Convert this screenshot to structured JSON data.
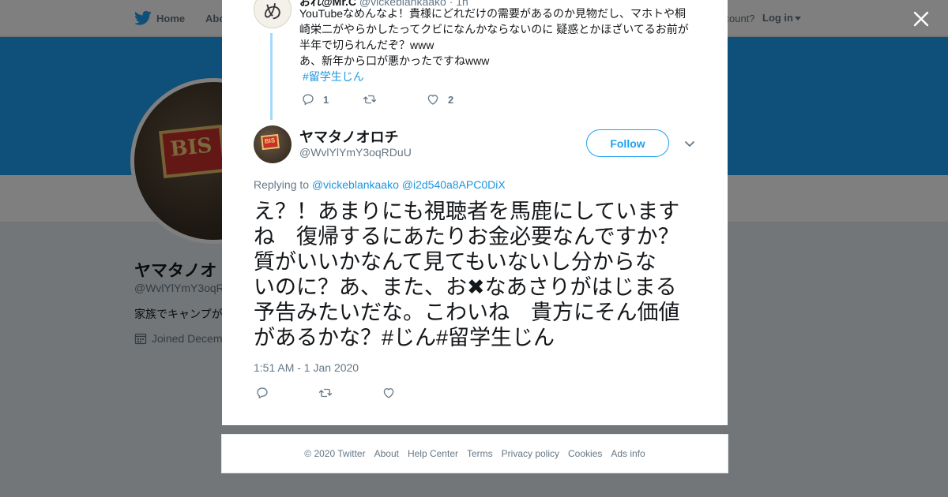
{
  "topnav": {
    "home_label": "Home",
    "about_label": "Abo",
    "account_prompt": "ccount?",
    "login_label": "Log in"
  },
  "profile": {
    "name": "ヤマタノオ",
    "handle": "@WvlYlYmY3oqR",
    "bio": "家族でキャンプが",
    "joined": "Joined Decem",
    "avatar_label": "BIS"
  },
  "reply_tweet": {
    "header_name": "おれ@Mr.C",
    "header_handle": "@vickeblankaako · 1h",
    "avatar_glyph": "め",
    "text_lines": [
      "YouTubeなめんなよ！貴様にどれだけの需要があるのか見物だし、マホトや桐",
      "崎栄二がやらかしたってクビになんかならないのに 疑惑とかほざいてるお前が",
      "半年で切られんだぞ？www",
      "あ、新年から口が悪かったですねwww"
    ],
    "hashtag": "#留学生じん",
    "reply_count": "1",
    "retweet_count": "",
    "like_count": "2"
  },
  "main_tweet": {
    "name": "ヤマタノオロチ",
    "handle": "@WvlYlYmY3oqRDuU",
    "avatar_label": "BIS",
    "follow_label": "Follow",
    "replying_prefix": "Replying to",
    "replying_mentions": [
      "@vickeblankaako",
      "@i2d540a8APC0DiX"
    ],
    "text_lines": [
      "え？！あまりにも視聴者を馬鹿にしています",
      "ね　復帰するにあたりお金必要なんですか？",
      "質がいいかなんて見てもいないし分からな",
      "いのに？あ、また、お✖なあさりがはじまる",
      "予告みたいだな。こわいね　貴方にそん価値",
      "があるかな？#じん#留学生じん"
    ],
    "timestamp": "1:51 AM - 1 Jan 2020"
  },
  "footer": {
    "copyright": "© 2020 Twitter",
    "links": [
      "About",
      "Help Center",
      "Terms",
      "Privacy policy",
      "Cookies",
      "Ads info"
    ]
  },
  "colors": {
    "brand": "#1da1f2",
    "link": "#1b95e0",
    "muted": "#657786",
    "overlay": "rgba(0,0,0,0.5)"
  },
  "icons": {
    "logo": "twitter-bird-icon",
    "close": "close-icon",
    "reply": "reply-icon",
    "retweet": "retweet-icon",
    "like": "heart-icon",
    "more": "chevron-down-icon",
    "calendar": "calendar-icon"
  }
}
